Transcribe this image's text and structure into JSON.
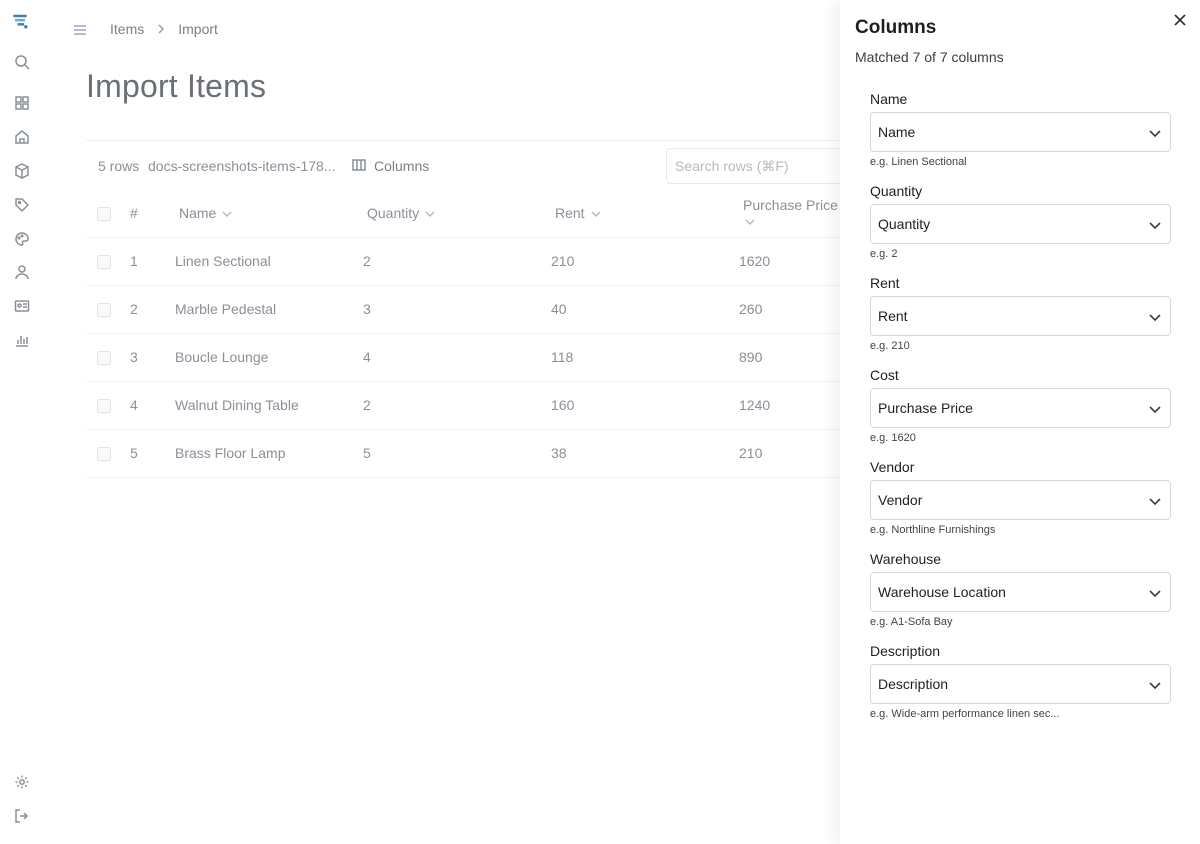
{
  "breadcrumb": {
    "items_label": "Items",
    "current": "Import"
  },
  "page_title": "Import Items",
  "toolbar": {
    "row_count": "5 rows",
    "file_name": "docs-screenshots-items-178...",
    "columns_label": "Columns",
    "search_placeholder": "Search rows (⌘F)"
  },
  "table": {
    "headers": {
      "num": "#",
      "name": "Name",
      "quantity": "Quantity",
      "rent": "Rent",
      "price": "Purchase Price"
    },
    "rows": [
      {
        "num": "1",
        "name": "Linen Sectional",
        "quantity": "2",
        "rent": "210",
        "price": "1620"
      },
      {
        "num": "2",
        "name": "Marble Pedestal",
        "quantity": "3",
        "rent": "40",
        "price": "260"
      },
      {
        "num": "3",
        "name": "Boucle Lounge",
        "quantity": "4",
        "rent": "118",
        "price": "890"
      },
      {
        "num": "4",
        "name": "Walnut Dining Table",
        "quantity": "2",
        "rent": "160",
        "price": "1240"
      },
      {
        "num": "5",
        "name": "Brass Floor Lamp",
        "quantity": "5",
        "rent": "38",
        "price": "210"
      }
    ]
  },
  "panel": {
    "title": "Columns",
    "subtitle": "Matched 7 of 7 columns",
    "fields": [
      {
        "label": "Name",
        "value": "Name",
        "example": "e.g. Linen Sectional"
      },
      {
        "label": "Quantity",
        "value": "Quantity",
        "example": "e.g. 2"
      },
      {
        "label": "Rent",
        "value": "Rent",
        "example": "e.g. 210"
      },
      {
        "label": "Cost",
        "value": "Purchase Price",
        "example": "e.g. 1620"
      },
      {
        "label": "Vendor",
        "value": "Vendor",
        "example": "e.g. Northline Furnishings"
      },
      {
        "label": "Warehouse",
        "value": "Warehouse Location",
        "example": "e.g. A1-Sofa Bay"
      },
      {
        "label": "Description",
        "value": "Description",
        "example": "e.g. Wide-arm performance linen sec..."
      }
    ]
  },
  "icons": {
    "rail": [
      "logo-icon",
      "search-icon",
      "dashboard-icon",
      "home-icon",
      "box-icon",
      "tag-icon",
      "palette-icon",
      "user-icon",
      "id-card-icon",
      "chart-icon",
      "settings-icon",
      "logout-icon"
    ]
  }
}
